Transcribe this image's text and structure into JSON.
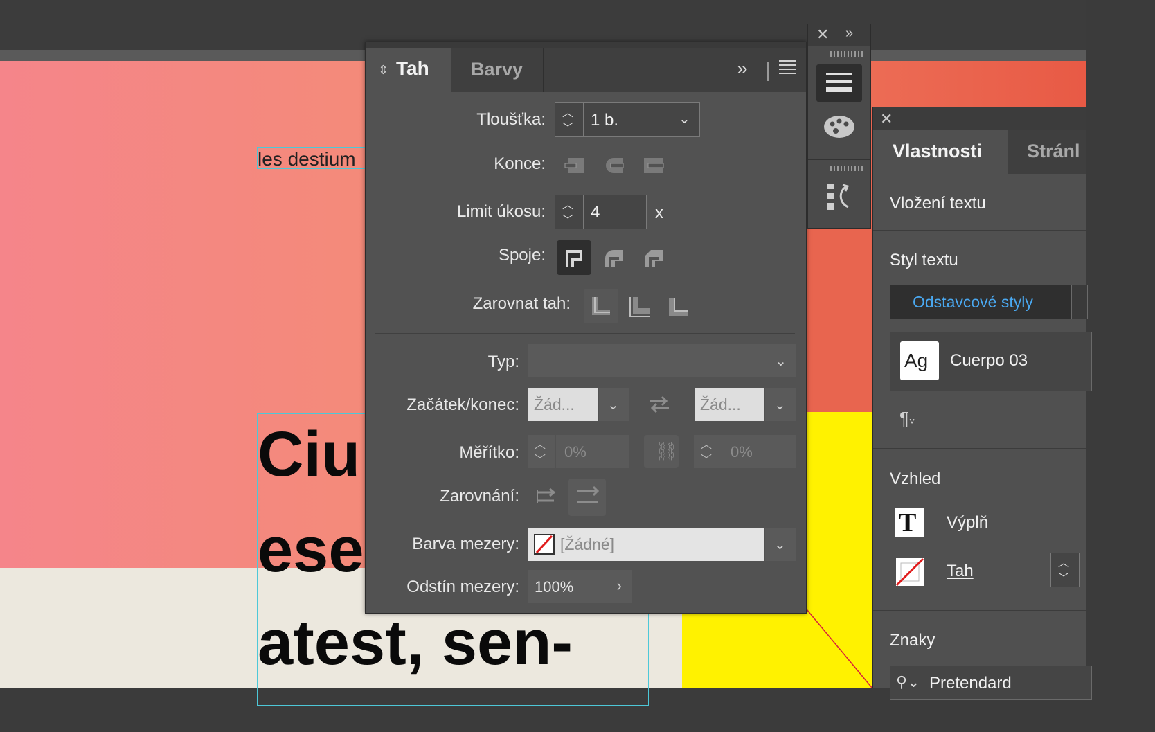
{
  "canvas": {
    "small_text": "les destium",
    "big_lines": [
      "Ciu",
      "ese",
      "atest, sen-"
    ]
  },
  "stroke_panel": {
    "tabs": [
      "Tah",
      "Barvy"
    ],
    "weight": {
      "label": "Tloušťka:",
      "value": "1 b."
    },
    "caps_label": "Konce:",
    "miter": {
      "label": "Limit úkosu:",
      "value": "4",
      "suffix": "x"
    },
    "joins_label": "Spoje:",
    "align_label": "Zarovnat tah:",
    "type_label": "Typ:",
    "startend": {
      "label": "Začátek/konec:",
      "start": "Žád...",
      "end": "Žád..."
    },
    "scale": {
      "label": "Měřítko:",
      "start": "0%",
      "end": "0%"
    },
    "alignment_label": "Zarovnání:",
    "gap_color": {
      "label": "Barva mezery:",
      "value": "[Žádné]"
    },
    "gap_tint": {
      "label": "Odstín mezery:",
      "value": "100%"
    }
  },
  "properties_panel": {
    "tabs": [
      "Vlastnosti",
      "Stránl"
    ],
    "context": "Vložení textu",
    "text_style": {
      "heading": "Styl textu",
      "tab": "Odstavcové styly",
      "style_preview": "Ag",
      "style_name": "Cuerpo 03",
      "pilcrow": "¶"
    },
    "appearance": {
      "heading": "Vzhled",
      "fill": "Výplň",
      "stroke": "Tah"
    },
    "chars": {
      "heading": "Znaky",
      "font": "Pretendard"
    }
  },
  "colors": {
    "accent": "#4aa8f0",
    "frame": "#4dc8d8",
    "yellow": "#fff200",
    "cream": "#ece8de"
  }
}
